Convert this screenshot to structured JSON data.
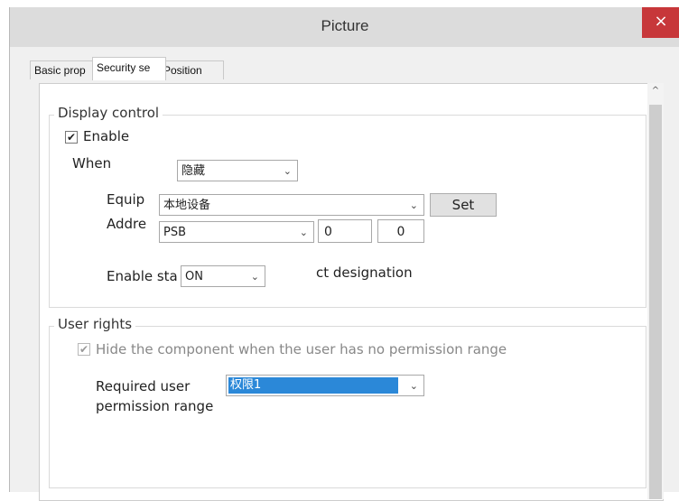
{
  "window": {
    "title": "Picture",
    "close_symbol": "×"
  },
  "tabs": [
    {
      "label": "Basic prop"
    },
    {
      "label": "Security se"
    },
    {
      "label": "Position"
    }
  ],
  "display_control": {
    "legend": "Display control",
    "enable_checked": true,
    "enable_label": "Enable",
    "when_label": "When",
    "when_value": "隐藏",
    "equip_label": "Equip",
    "equip_value": "本地设备",
    "set_button": "Set",
    "addr_label": "Addre",
    "addr_type": "PSB",
    "addr_value1": "0",
    "addr_value2": "0",
    "enable_state_label": "Enable sta",
    "enable_state_value": "ON",
    "ct_designation": "ct designation"
  },
  "user_rights": {
    "legend": "User rights",
    "hide_checked": true,
    "hide_label": "Hide the component when the user has no permission range",
    "required_label_line1": "Required user",
    "required_label_line2": "permission range",
    "permission_value": "权限1"
  },
  "icons": {
    "check": "✔",
    "dropdown": "⌄",
    "scroll_up": "^"
  }
}
